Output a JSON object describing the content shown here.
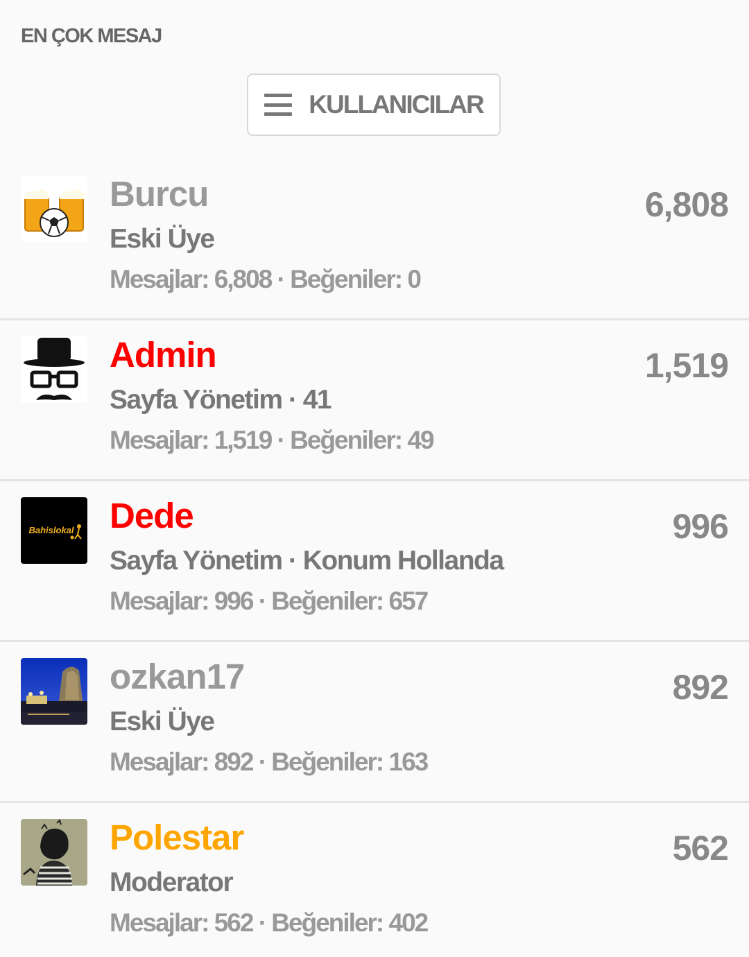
{
  "section_title": "EN ÇOK MESAJ",
  "menu_button": {
    "icon": "hamburger-menu-icon",
    "label": "KULLANICILAR"
  },
  "users": [
    {
      "name": "Burcu",
      "name_color": "#999999",
      "title": "Eski Üye",
      "stats": "Mesajlar: 6,808 · Beğeniler: 0",
      "count": "6,808",
      "avatar": "beer-mugs-football-avatar"
    },
    {
      "name": "Admin",
      "name_color": "#ff0000",
      "title": "Sayfa Yönetim · 41",
      "stats": "Mesajlar: 1,519 · Beğeniler: 49",
      "count": "1,519",
      "avatar": "hat-glasses-mustache-avatar"
    },
    {
      "name": "Dede",
      "name_color": "#ff0000",
      "title": "Sayfa Yönetim · Konum Hollanda",
      "stats": "Mesajlar: 996 · Beğeniler: 657",
      "count": "996",
      "avatar": "bahislokal-logo-avatar",
      "avatar_text": "Bahislokal"
    },
    {
      "name": "ozkan17",
      "name_color": "#999999",
      "title": "Eski Üye",
      "stats": "Mesajlar: 892 · Beğeniler: 163",
      "count": "892",
      "avatar": "night-city-photo-avatar"
    },
    {
      "name": "Polestar",
      "name_color": "#ffa500",
      "title": "Moderator",
      "stats": "Mesajlar: 562 · Beğeniler: 402",
      "count": "562",
      "avatar": "hooded-figure-photo-avatar"
    }
  ]
}
